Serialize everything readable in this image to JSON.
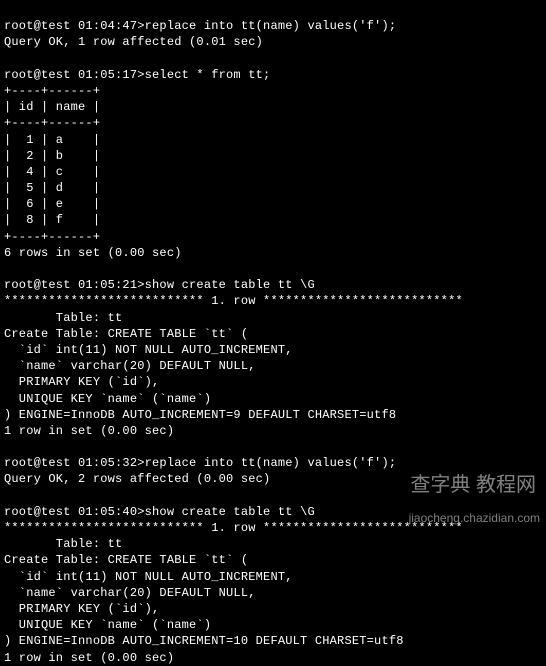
{
  "block1": {
    "prompt": "root@test 01:04:47>replace into tt(name) values('f');",
    "result": "Query OK, 1 row affected (0.01 sec)"
  },
  "block2": {
    "prompt": "root@test 01:05:17>select * from tt;",
    "sep": "+----+------+",
    "header": "| id | name |",
    "rows": [
      "|  1 | a    |",
      "|  2 | b    |",
      "|  4 | c    |",
      "|  5 | d    |",
      "|  6 | e    |",
      "|  8 | f    |"
    ],
    "result": "6 rows in set (0.00 sec)"
  },
  "block3": {
    "prompt": "root@test 01:05:21>show create table tt \\G",
    "rowheader": "*************************** 1. row ***************************",
    "l1": "       Table: tt",
    "l2": "Create Table: CREATE TABLE `tt` (",
    "l3": "  `id` int(11) NOT NULL AUTO_INCREMENT,",
    "l4": "  `name` varchar(20) DEFAULT NULL,",
    "l5": "  PRIMARY KEY (`id`),",
    "l6": "  UNIQUE KEY `name` (`name`)",
    "l7": ") ENGINE=InnoDB AUTO_INCREMENT=9 DEFAULT CHARSET=utf8",
    "result": "1 row in set (0.00 sec)"
  },
  "block4": {
    "prompt": "root@test 01:05:32>replace into tt(name) values('f');",
    "result": "Query OK, 2 rows affected (0.00 sec)"
  },
  "block5": {
    "prompt": "root@test 01:05:40>show create table tt \\G",
    "rowheader": "*************************** 1. row ***************************",
    "l1": "       Table: tt",
    "l2": "Create Table: CREATE TABLE `tt` (",
    "l3": "  `id` int(11) NOT NULL AUTO_INCREMENT,",
    "l4": "  `name` varchar(20) DEFAULT NULL,",
    "l5": "  PRIMARY KEY (`id`),",
    "l6": "  UNIQUE KEY `name` (`name`)",
    "l7": ") ENGINE=InnoDB AUTO_INCREMENT=10 DEFAULT CHARSET=utf8",
    "result": "1 row in set (0.00 sec)"
  },
  "watermark1": "查字典 教程网",
  "watermark2": "jiaocheng.chazidian.com"
}
